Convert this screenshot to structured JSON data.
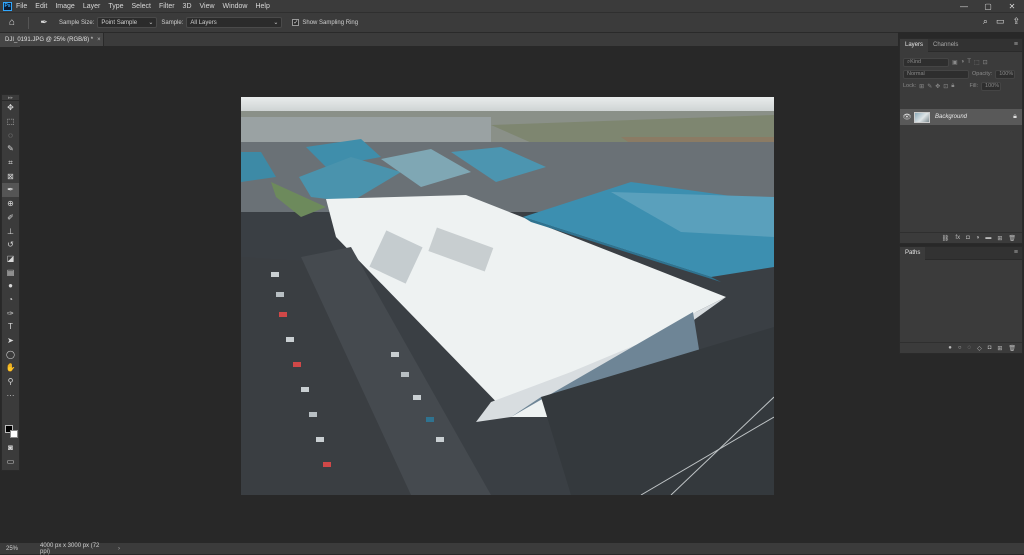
{
  "app": {
    "logo": "Ps"
  },
  "menu": [
    "File",
    "Edit",
    "Image",
    "Layer",
    "Type",
    "Select",
    "Filter",
    "3D",
    "View",
    "Window",
    "Help"
  ],
  "window_controls": [
    "—",
    "▢",
    "✕"
  ],
  "options": {
    "sample_size_label": "Sample Size:",
    "sample_size_value": "Point Sample",
    "sample_label": "Sample:",
    "sample_value": "All Layers",
    "show_ring_label": "Show Sampling Ring",
    "show_ring_checked": true
  },
  "document_tab": {
    "title": "DJI_0191.JPG @ 25% (RGB/8) *",
    "close": "×"
  },
  "tools": [
    "move-tool",
    "marquee-tool",
    "lasso-tool",
    "quick-select-tool",
    "crop-tool",
    "frame-tool",
    "eyedropper-tool",
    "healing-brush-tool",
    "brush-tool",
    "clone-stamp-tool",
    "history-brush-tool",
    "eraser-tool",
    "gradient-tool",
    "blur-tool",
    "dodge-tool",
    "pen-tool",
    "type-tool",
    "path-select-tool",
    "ellipse-tool",
    "hand-tool",
    "zoom-tool",
    "more-tools"
  ],
  "active_tool": "eyedropper-tool",
  "colors": {
    "foreground": "#000000",
    "background": "#ffffff",
    "accent": "#31a8ff"
  },
  "status": {
    "zoom": "25%",
    "info": "4000 px x 3000 px (72 ppi)"
  },
  "layers_panel": {
    "tabs": [
      "Layers",
      "Channels"
    ],
    "kind_placeholder": "Kind",
    "blend_mode": "Normal",
    "opacity_label": "Opacity:",
    "opacity_value": "100%",
    "lock_label": "Lock:",
    "fill_label": "Fill:",
    "fill_value": "100%",
    "layers": [
      {
        "name": "Background",
        "visible": true,
        "locked": true
      }
    ],
    "footer_icons": [
      "link-icon",
      "fx-icon",
      "mask-icon",
      "adjustment-icon",
      "group-icon",
      "new-layer-icon",
      "delete-icon"
    ]
  },
  "paths_panel": {
    "tabs": [
      "Paths"
    ],
    "footer_icons": [
      "fill-path-icon",
      "stroke-path-icon",
      "load-selection-icon",
      "make-path-icon",
      "mask-icon",
      "new-path-icon",
      "delete-icon"
    ]
  }
}
